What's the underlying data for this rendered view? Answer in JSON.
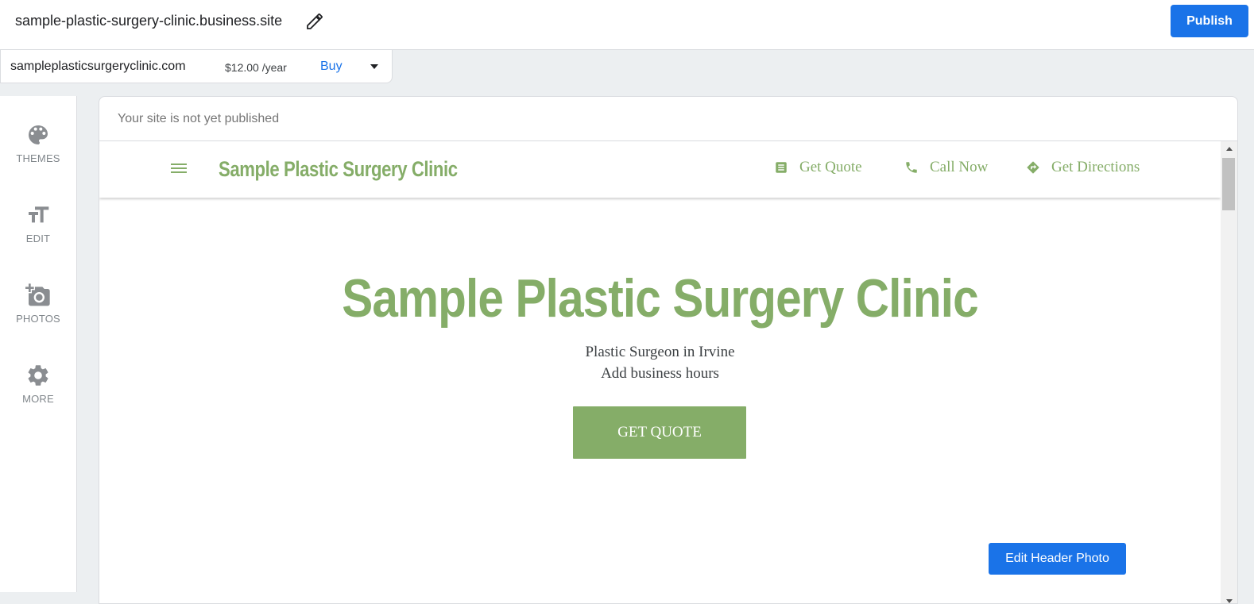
{
  "topbar": {
    "site_url": "sample-plastic-surgery-clinic.business.site",
    "edit_icon": "pencil-icon",
    "publish_label": "Publish",
    "accent_color": "#1a73e8"
  },
  "domain": {
    "name": "sampleplasticsurgeryclinic.com",
    "price": "$12.00 /year",
    "buy_label": "Buy",
    "menu_icon": "caret-down-icon"
  },
  "sidebar": {
    "items": [
      {
        "label": "THEMES",
        "icon": "palette-icon"
      },
      {
        "label": "EDIT",
        "icon": "text-size-icon"
      },
      {
        "label": "PHOTOS",
        "icon": "add-photo-icon"
      },
      {
        "label": "MORE",
        "icon": "gear-icon"
      }
    ]
  },
  "preview": {
    "status": "Your site is not yet published",
    "nav": {
      "menu_icon": "hamburger-icon",
      "brand": "Sample Plastic Surgery Clinic",
      "links": [
        {
          "label": "Get Quote",
          "icon": "quote-doc-icon"
        },
        {
          "label": "Call Now",
          "icon": "phone-icon"
        },
        {
          "label": "Get Directions",
          "icon": "directions-icon"
        }
      ]
    },
    "hero": {
      "title": "Sample Plastic Surgery Clinic",
      "subtitle": "Plastic Surgeon in Irvine",
      "hours": "Add business hours",
      "cta": "GET QUOTE"
    },
    "edit_header_photo": "Edit Header Photo",
    "theme_color": "#85ad68"
  }
}
